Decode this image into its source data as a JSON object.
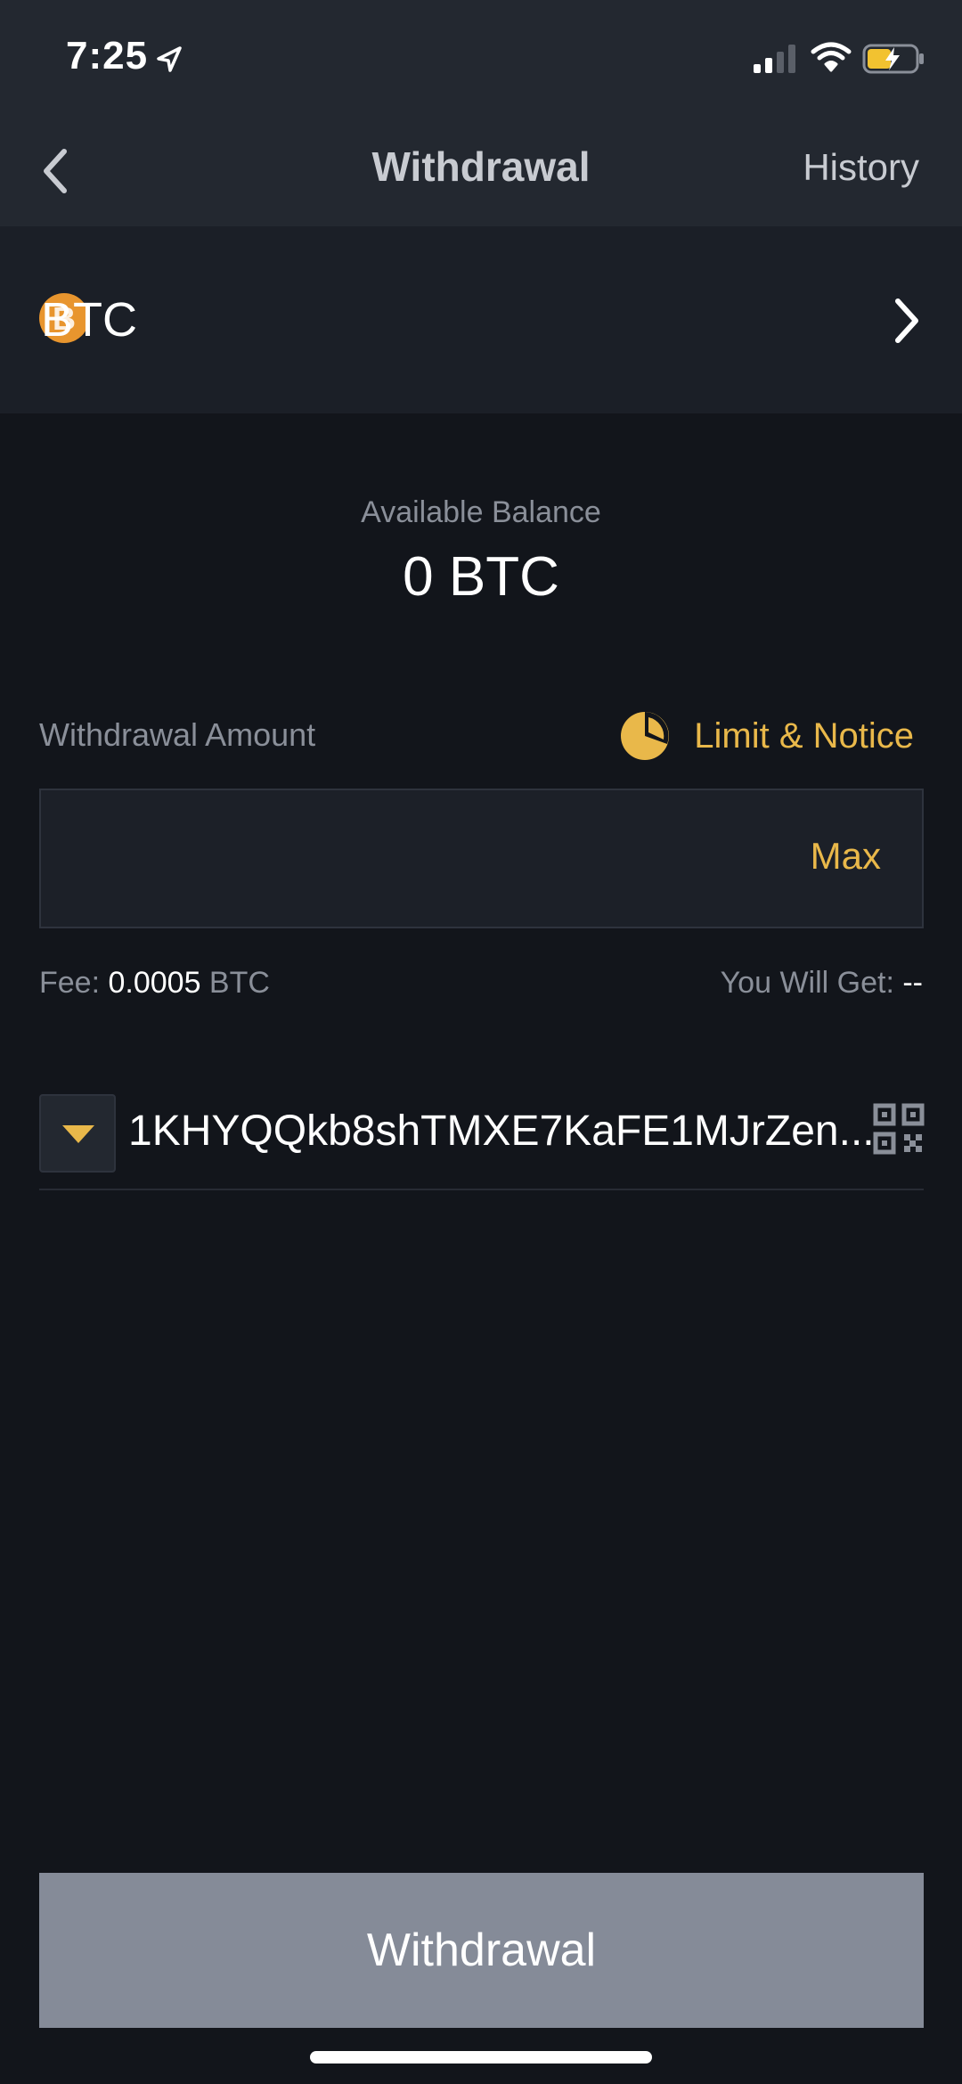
{
  "status_bar": {
    "time": "7:25",
    "icons": [
      "location-arrow-icon",
      "cellular-signal-icon",
      "wifi-icon",
      "battery-charging-icon"
    ]
  },
  "nav": {
    "title": "Withdrawal",
    "history_label": "History",
    "back_icon": "chevron-left-icon"
  },
  "coin": {
    "symbol": "BTC",
    "icon": "bitcoin-icon",
    "icon_glyph": "B",
    "chevron_icon": "chevron-right-icon"
  },
  "balance": {
    "label": "Available Balance",
    "value": "0 BTC"
  },
  "amount": {
    "label": "Withdrawal Amount",
    "limit_notice_label": "Limit & Notice",
    "limit_icon": "pie-chart-icon",
    "value": "",
    "max_label": "Max"
  },
  "fee": {
    "label": "Fee: ",
    "value": "0.0005",
    "unit": " BTC"
  },
  "you_will_get": {
    "label": "You Will Get: ",
    "value": "--"
  },
  "address": {
    "value": "1KHYQQkb8shTMXE7KaFE1MJrZen...",
    "dropdown_icon": "caret-down-icon",
    "scan_icon": "qr-code-icon"
  },
  "submit": {
    "label": "Withdrawal"
  },
  "colors": {
    "accent": "#e9b84a",
    "background": "#12151b",
    "header": "#232830",
    "button_disabled": "#858b98",
    "bitcoin": "#e8952e"
  }
}
